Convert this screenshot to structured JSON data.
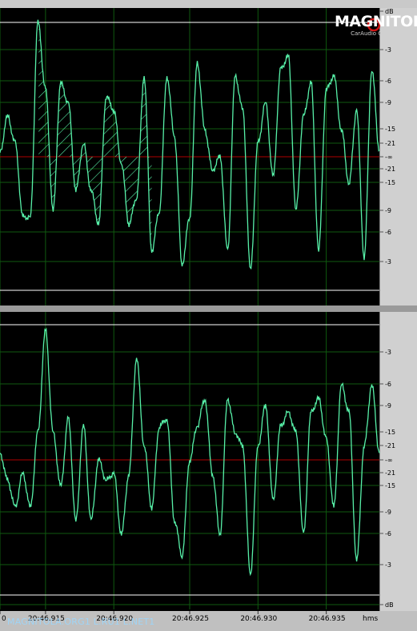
{
  "logo": {
    "brand": "MAGNITOLA",
    "subtitle": "CarAudio Club"
  },
  "watermark": "MAGNITOLA.ORG1 L.RU1 L.NET1",
  "time_unit": "hms",
  "colors": {
    "waveform": "#57f0a8",
    "center_line": "#b00000",
    "clip_line": "#ffffff",
    "grid": "#0f5a0f",
    "background": "#000000"
  },
  "chart_data": [
    {
      "type": "line",
      "name": "left-channel",
      "y_unit": "dB",
      "ytick_labels": [
        "dB",
        "-3",
        "-6",
        "-9",
        "-15",
        "-21",
        "-∞",
        "-21",
        "-15",
        "-9",
        "-6",
        "-3"
      ],
      "ylim": [
        -1,
        1
      ],
      "highlight": "hatched",
      "x": [
        0.0,
        0.02,
        0.04,
        0.06,
        0.08,
        0.1,
        0.12,
        0.14,
        0.16,
        0.18,
        0.2,
        0.22,
        0.24,
        0.26,
        0.28,
        0.3,
        0.32,
        0.34,
        0.36,
        0.38,
        0.4,
        0.42,
        0.44,
        0.46,
        0.48,
        0.5,
        0.52,
        0.54,
        0.56,
        0.58,
        0.6,
        0.62,
        0.64,
        0.66,
        0.68,
        0.7,
        0.72,
        0.74,
        0.76,
        0.78,
        0.8,
        0.82,
        0.84,
        0.86,
        0.88,
        0.9,
        0.92,
        0.94,
        0.96,
        0.98,
        1.0
      ],
      "values": [
        0.03,
        0.3,
        0.1,
        -0.45,
        -0.45,
        1.0,
        0.5,
        -0.4,
        0.55,
        0.4,
        -0.25,
        0.1,
        -0.25,
        -0.5,
        0.45,
        0.35,
        -0.05,
        -0.5,
        -0.3,
        0.6,
        -0.7,
        -0.4,
        0.6,
        0.15,
        -0.8,
        -0.45,
        0.7,
        0.2,
        -0.1,
        0.0,
        -0.7,
        0.6,
        0.35,
        -0.85,
        0.1,
        0.4,
        -0.15,
        0.65,
        0.75,
        -0.4,
        0.3,
        0.55,
        -0.7,
        0.5,
        0.6,
        0.2,
        -0.2,
        0.35,
        -0.75,
        0.65,
        0.05
      ]
    },
    {
      "type": "line",
      "name": "right-channel",
      "y_unit": "dB",
      "ytick_labels": [
        "-3",
        "-6",
        "-9",
        "-15",
        "-21",
        "-∞",
        "-21",
        "-15",
        "-9",
        "-6",
        "-3",
        "dB"
      ],
      "ylim": [
        -1,
        1
      ],
      "x": [
        0.0,
        0.02,
        0.04,
        0.06,
        0.08,
        0.1,
        0.12,
        0.14,
        0.16,
        0.18,
        0.2,
        0.22,
        0.24,
        0.26,
        0.28,
        0.3,
        0.32,
        0.34,
        0.36,
        0.38,
        0.4,
        0.42,
        0.44,
        0.46,
        0.48,
        0.5,
        0.52,
        0.54,
        0.56,
        0.58,
        0.6,
        0.62,
        0.64,
        0.66,
        0.68,
        0.7,
        0.72,
        0.74,
        0.76,
        0.78,
        0.8,
        0.82,
        0.84,
        0.86,
        0.88,
        0.9,
        0.92,
        0.94,
        0.96,
        0.98,
        1.0
      ],
      "values": [
        0.05,
        -0.15,
        -0.35,
        -0.1,
        -0.35,
        0.2,
        0.95,
        0.2,
        -0.2,
        0.3,
        -0.45,
        0.25,
        -0.45,
        0.0,
        -0.15,
        -0.1,
        -0.55,
        -0.1,
        0.75,
        0.1,
        -0.35,
        0.25,
        0.3,
        -0.45,
        -0.7,
        0.0,
        0.25,
        0.45,
        -0.1,
        -0.55,
        0.45,
        0.2,
        0.1,
        -0.85,
        0.1,
        0.4,
        -0.3,
        0.25,
        0.35,
        0.2,
        -0.55,
        0.35,
        0.45,
        0.15,
        -0.35,
        0.55,
        0.35,
        -0.75,
        0.1,
        0.55,
        0.05
      ]
    },
    {
      "type": "axis",
      "name": "time-axis",
      "xtick_labels": [
        "0",
        "20:46.915",
        "20:46.920",
        "20:46.925",
        "20:46.930",
        "20:46.935"
      ],
      "xtick_positions": [
        0.0,
        0.12,
        0.3,
        0.5,
        0.68,
        0.86
      ]
    }
  ]
}
